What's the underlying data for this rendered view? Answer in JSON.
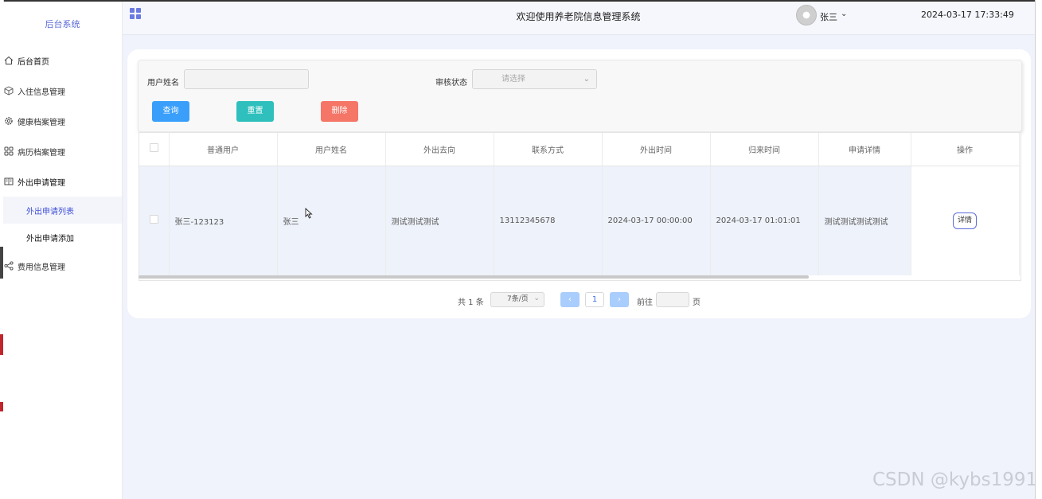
{
  "sidebar": {
    "brand": "后台系统",
    "items": [
      {
        "label": "后台首页",
        "icon": "home-icon"
      },
      {
        "label": "入住信息管理",
        "icon": "cube-icon"
      },
      {
        "label": "健康档案管理",
        "icon": "gear-icon"
      },
      {
        "label": "病历档案管理",
        "icon": "grid-icon"
      },
      {
        "label": "外出申请管理",
        "icon": "book-icon"
      },
      {
        "label": "外出申请列表",
        "icon": ""
      },
      {
        "label": "外出申请添加",
        "icon": ""
      },
      {
        "label": "费用信息管理",
        "icon": "share-icon"
      }
    ]
  },
  "header": {
    "title": "欢迎使用养老院信息管理系统",
    "user": "张三",
    "caret": "⌄",
    "datetime": "2024-03-17 17:33:49"
  },
  "search": {
    "username_label": "用户姓名",
    "username_value": "",
    "status_label": "审核状态",
    "status_placeholder": "请选择",
    "caret": "⌄",
    "query_button": "查询",
    "reset_button": "重置",
    "delete_button": "删除"
  },
  "table": {
    "headers": [
      "普通用户",
      "用户姓名",
      "外出去向",
      "联系方式",
      "外出时间",
      "归来时间",
      "申请详情",
      "操作"
    ],
    "rows": [
      {
        "user": "张三-123123",
        "name": "张三",
        "destination": "测试测试测试",
        "contact": "13112345678",
        "out_time": "2024-03-17 00:00:00",
        "return_time": "2024-03-17 01:01:01",
        "detail": "测试测试测试测试",
        "action": "详情"
      }
    ]
  },
  "pagination": {
    "total": "共 1 条",
    "page_size": "7条/页",
    "page_size_caret": "⌄",
    "prev": "‹",
    "current_page": "1",
    "next": "›",
    "goto_label": "前往",
    "goto_value": "",
    "page_suffix": "页"
  },
  "watermark": "CSDN @kybs1991",
  "colors": {
    "accent": "#5b6bd8",
    "query": "#3a9ffb",
    "reset": "#2fc0bd",
    "delete": "#f57567",
    "pager_btn": "#a9cdfc"
  }
}
